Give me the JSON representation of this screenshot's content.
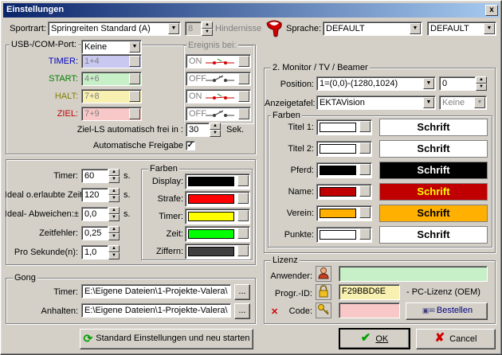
{
  "window": {
    "title": "Einstellungen",
    "close": "x"
  },
  "top": {
    "sportart_label": "Sportrart:",
    "sportart_value": "Springreiten Standard (A)",
    "hindernis_value": "8",
    "hindernis_label": "Hindernisse",
    "sprache_label": "Sprache:",
    "sprache_value": "DEFAULT",
    "sprache2_value": "DEFAULT"
  },
  "usb": {
    "port_label": "USB-/COM-Port:",
    "port_value": "Keine",
    "ereignis_label": "Ereignis bei:",
    "rows": [
      {
        "label": "TIMER:",
        "value": "1+4",
        "state": "ON",
        "label_color": "#0000c0",
        "bg": "#c8c8f0"
      },
      {
        "label": "START:",
        "value": "4+6",
        "state": "OFF",
        "label_color": "#008000",
        "bg": "#c8f0c8"
      },
      {
        "label": "HALT:",
        "value": "7+8",
        "state": "ON",
        "label_color": "#808000",
        "bg": "#f8f0b0"
      },
      {
        "label": "ZIEL:",
        "value": "7+9",
        "state": "OFF",
        "label_color": "#c00000",
        "bg": "#f8c8c8"
      }
    ],
    "ziel_label": "Ziel-LS automatisch frei in :",
    "ziel_value": "30",
    "ziel_unit": "Sek.",
    "auto_label": "Automatische Freigabe",
    "auto_checked": "✓"
  },
  "timing": {
    "rows": [
      {
        "label": "Timer:",
        "value": "60",
        "unit": "s."
      },
      {
        "label": "Ideal o.erlaubte Zeit:",
        "value": "120",
        "unit": "s."
      },
      {
        "label": "Ideal- Abweichen:±",
        "value": "0,0",
        "unit": "s."
      },
      {
        "label": "Zeitfehler:",
        "value": "0,25",
        "unit": ""
      },
      {
        "label": "Pro Sekunde(n):",
        "value": "1,0",
        "unit": ""
      }
    ]
  },
  "farben_left": {
    "title": "Farben",
    "rows": [
      {
        "label": "Display:",
        "color": "#000000"
      },
      {
        "label": "Strafe:",
        "color": "#ff0000"
      },
      {
        "label": "Timer:",
        "color": "#ffff00"
      },
      {
        "label": "Zeit:",
        "color": "#00ff00"
      },
      {
        "label": "Ziffern:",
        "color": "#404040"
      }
    ]
  },
  "gong": {
    "title": "Gong",
    "timer_label": "Timer:",
    "timer_value": "E:\\Eigene Dateien\\1-Projekte-Valera\\",
    "anhalten_label": "Anhalten:",
    "anhalten_value": "E:\\Eigene Dateien\\1-Projekte-Valera\\",
    "browse": "..."
  },
  "monitor": {
    "title": "2. Monitor / TV / Beamer",
    "position_label": "Position:",
    "position_value": "1=(0,0)-(1280,1024)",
    "position_num": "0",
    "anzeige_label": "Anzeigetafel:",
    "anzeige_value": "EKTAVision",
    "anzeige_value2": "Keine"
  },
  "farben_right": {
    "title": "Farben",
    "schrift": "Schrift",
    "rows": [
      {
        "label": "Titel 1:",
        "color": "#ffffff",
        "btn_bg": "#ffffff",
        "btn_fg": "#000000"
      },
      {
        "label": "Titel 2:",
        "color": "#ffffff",
        "btn_bg": "#ffffff",
        "btn_fg": "#000000"
      },
      {
        "label": "Pferd:",
        "color": "#000000",
        "btn_bg": "#000000",
        "btn_fg": "#ffffff"
      },
      {
        "label": "Name:",
        "color": "#c00000",
        "btn_bg": "#c00000",
        "btn_fg": "#ffff00"
      },
      {
        "label": "Verein:",
        "color": "#ffb000",
        "btn_bg": "#ffb000",
        "btn_fg": "#000000"
      },
      {
        "label": "Punkte:",
        "color": "#ffffff",
        "btn_bg": "#ffffff",
        "btn_fg": "#000000"
      }
    ]
  },
  "lizenz": {
    "title": "Lizenz",
    "anwender_label": "Anwender:",
    "anwender_value": "",
    "progid_label": "Progr.-ID:",
    "progid_value": "F29BBD6E",
    "pc_lizenz": "- PC-Lizenz (OEM)",
    "code_label": "Code:",
    "code_value": "",
    "x_mark": "✕",
    "bestellen": "Bestellen"
  },
  "buttons": {
    "standard": "Standard Einstellungen und neu starten",
    "ok": "OK",
    "cancel": "Cancel"
  }
}
